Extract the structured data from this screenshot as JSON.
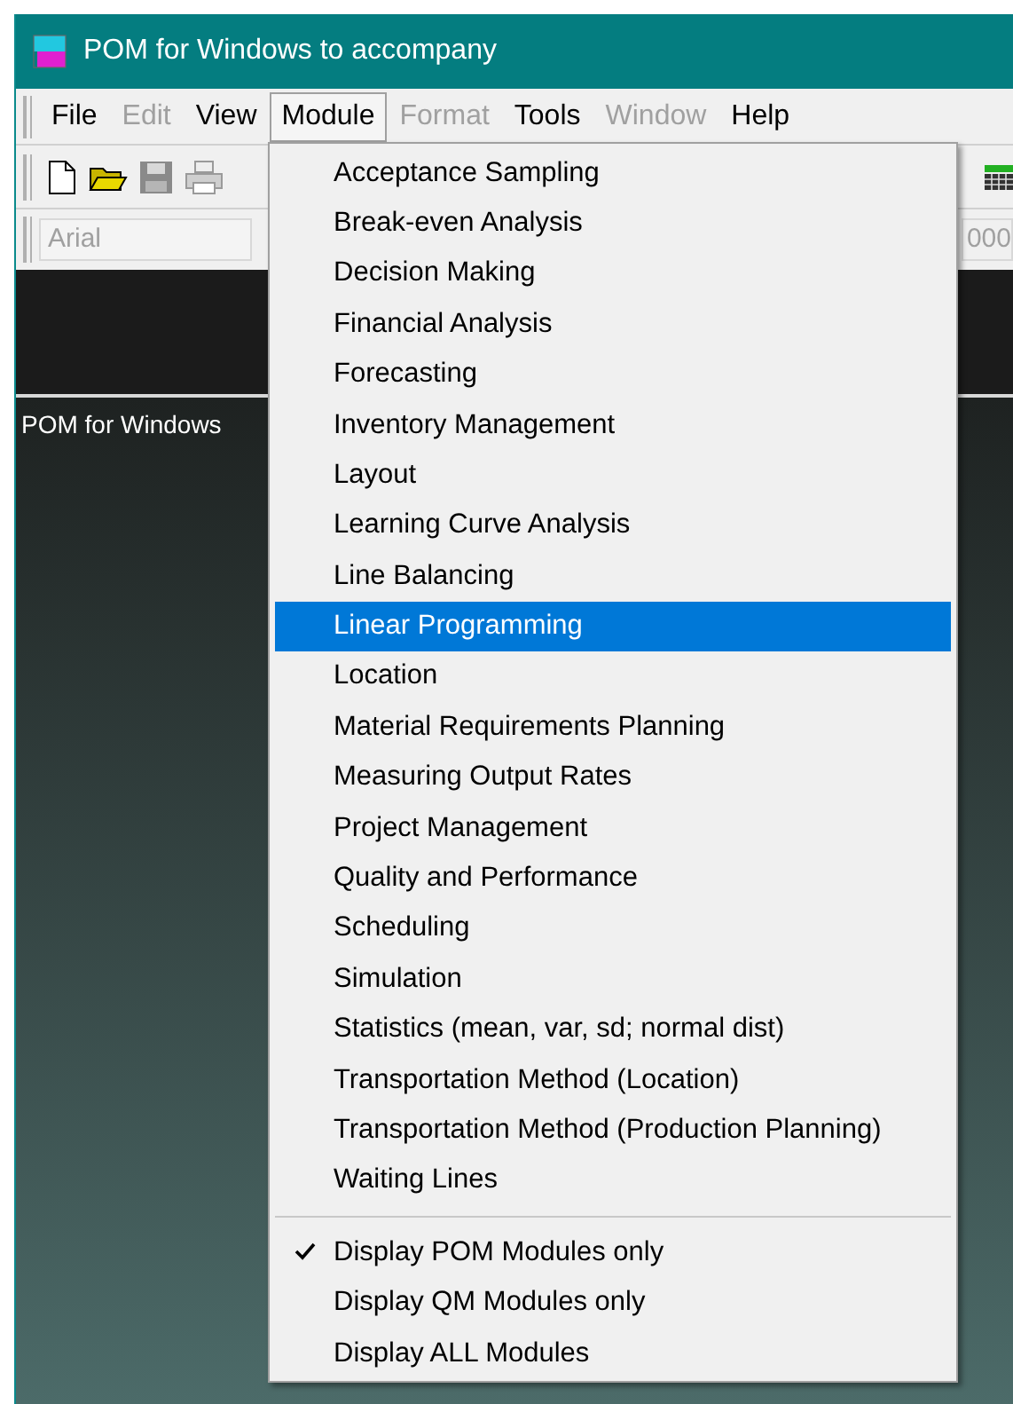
{
  "window": {
    "title": "POM for Windows to accompany"
  },
  "menu_bar": [
    {
      "label": "File",
      "disabled": false,
      "selected": false
    },
    {
      "label": "Edit",
      "disabled": true,
      "selected": false
    },
    {
      "label": "View",
      "disabled": false,
      "selected": false
    },
    {
      "label": "Module",
      "disabled": false,
      "selected": true
    },
    {
      "label": "Format",
      "disabled": true,
      "selected": false
    },
    {
      "label": "Tools",
      "disabled": false,
      "selected": false
    },
    {
      "label": "Window",
      "disabled": true,
      "selected": false
    },
    {
      "label": "Help",
      "disabled": false,
      "selected": false
    }
  ],
  "toolbar": [
    {
      "kind": "new",
      "disabled": false
    },
    {
      "kind": "open",
      "disabled": false
    },
    {
      "kind": "save",
      "disabled": true
    },
    {
      "kind": "print",
      "disabled": true
    }
  ],
  "font_bar": {
    "font": "Arial",
    "size_field": "000"
  },
  "workspace": {
    "caption": "POM for Windows"
  },
  "module_menu": {
    "modules": [
      {
        "label": "Acceptance Sampling",
        "selected": false
      },
      {
        "label": "Break-even Analysis",
        "selected": false
      },
      {
        "label": "Decision Making",
        "selected": false
      },
      {
        "label": "Financial Analysis",
        "selected": false
      },
      {
        "label": "Forecasting",
        "selected": false
      },
      {
        "label": "Inventory Management",
        "selected": false
      },
      {
        "label": "Layout",
        "selected": false
      },
      {
        "label": "Learning Curve Analysis",
        "selected": false
      },
      {
        "label": "Line Balancing",
        "selected": false
      },
      {
        "label": "Linear Programming",
        "selected": true
      },
      {
        "label": "Location",
        "selected": false
      },
      {
        "label": "Material Requirements Planning",
        "selected": false
      },
      {
        "label": "Measuring Output Rates",
        "selected": false
      },
      {
        "label": "Project Management",
        "selected": false
      },
      {
        "label": "Quality and Performance",
        "selected": false
      },
      {
        "label": "Scheduling",
        "selected": false
      },
      {
        "label": "Simulation",
        "selected": false
      },
      {
        "label": "Statistics (mean, var, sd; normal dist)",
        "selected": false
      },
      {
        "label": "Transportation Method (Location)",
        "selected": false
      },
      {
        "label": "Transportation Method (Production Planning)",
        "selected": false
      },
      {
        "label": "Waiting Lines",
        "selected": false
      }
    ],
    "display_options": [
      {
        "label": "Display POM Modules only",
        "checked": true
      },
      {
        "label": "Display QM Modules only",
        "checked": false
      },
      {
        "label": "Display ALL Modules",
        "checked": false
      }
    ]
  }
}
